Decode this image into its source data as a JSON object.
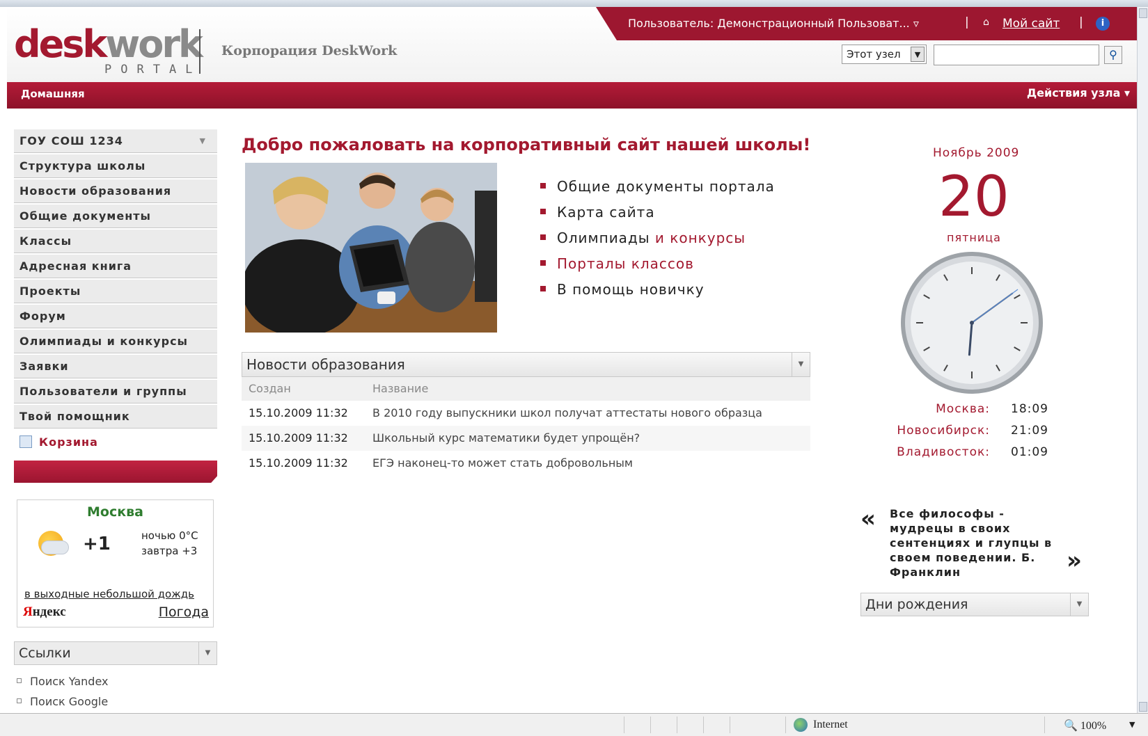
{
  "header": {
    "logo_main": "desk",
    "logo_accent": "work",
    "logo_sub": "PORTAL",
    "company": "Корпорация DeskWork",
    "user": "Пользователь: Демонстрационный Пользоват... ▿",
    "my_site": "Мой сайт",
    "scope_value": "Этот узел",
    "search_value": ""
  },
  "nav": {
    "home": "Домашняя",
    "site_actions": "Действия узла ▾"
  },
  "sidebar": {
    "items": [
      {
        "label": "ГОУ СОШ 1234"
      },
      {
        "label": "Структура школы"
      },
      {
        "label": "Новости образования"
      },
      {
        "label": "Общие документы"
      },
      {
        "label": "Классы"
      },
      {
        "label": "Адресная книга"
      },
      {
        "label": "Проекты"
      },
      {
        "label": "Форум"
      },
      {
        "label": "Олимпиады и конкурсы"
      },
      {
        "label": "Заявки"
      },
      {
        "label": "Пользователи и группы"
      },
      {
        "label": "Твой помощник"
      }
    ],
    "cart": "Корзина"
  },
  "weather": {
    "city": "Москва",
    "temp": "+1",
    "night": "ночью 0°C",
    "tomorrow": "завтра +3",
    "note": "в выходные небольшой дождь",
    "brand_first": "Я",
    "brand_rest": "ндекс",
    "link": "Погода"
  },
  "links": {
    "title": "Ссылки",
    "items": [
      "Поиск Yandex",
      "Поиск Google"
    ]
  },
  "main": {
    "welcome": "Добро пожаловать на корпоративный сайт нашей школы!",
    "bullets": [
      {
        "text": "Общие документы портала",
        "accent": ""
      },
      {
        "text": "Карта сайта",
        "accent": ""
      },
      {
        "text": "Олимпиады ",
        "accent": "и конкурсы"
      },
      {
        "text": "",
        "accent": "Порталы классов"
      },
      {
        "text": "В помощь новичку",
        "accent": ""
      }
    ]
  },
  "news": {
    "title": "Новости образования",
    "col_created": "Создан",
    "col_title": "Название",
    "rows": [
      {
        "date": "15.10.2009 11:32",
        "title": "В 2010 году выпускники школ получат аттестаты нового образца"
      },
      {
        "date": "15.10.2009 11:32",
        "title": "Школьный курс математики будет упрощён?"
      },
      {
        "date": "15.10.2009 11:32",
        "title": "ЕГЭ наконец-то может стать добровольным"
      }
    ]
  },
  "calendar": {
    "month": "Ноябрь 2009",
    "day": "20",
    "weekday": "пятница"
  },
  "clock": {
    "hours": 18,
    "minutes": 9
  },
  "cities": [
    {
      "city": "Москва:",
      "time": "18:09"
    },
    {
      "city": "Новосибирск:",
      "time": "21:09"
    },
    {
      "city": "Владивосток:",
      "time": "01:09"
    }
  ],
  "quote": {
    "text": "Все философы - мудрецы в своих сентенциях и глупцы в своем поведении. Б. Франклин"
  },
  "birthdays": {
    "title": "Дни рождения"
  },
  "statusbar": {
    "zone": "Internet",
    "zoom": "100%"
  },
  "colors": {
    "brand": "#a3192f",
    "weather_city": "#2f7d2f"
  }
}
